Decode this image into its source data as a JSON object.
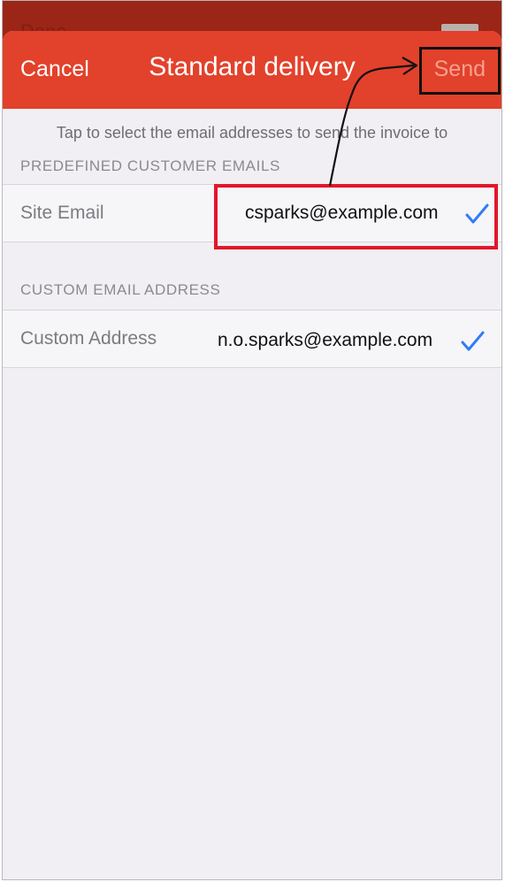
{
  "behind": {
    "label": "Done"
  },
  "navbar": {
    "cancel_label": "Cancel",
    "title": "Standard delivery",
    "send_label": "Send"
  },
  "hint": "Tap to select the email addresses to send the invoice to",
  "sections": [
    {
      "header": "PREDEFINED CUSTOMER EMAILS",
      "rows": [
        {
          "label": "Site Email",
          "value": "csparks@example.com",
          "checked": true
        }
      ]
    },
    {
      "header": "CUSTOM EMAIL ADDRESS",
      "rows": [
        {
          "label": "Custom Address",
          "value": "n.o.sparks@example.com",
          "checked": true
        }
      ]
    }
  ],
  "colors": {
    "accent": "#e2412b",
    "check": "#2f7df6",
    "highlight": "#e3162a"
  },
  "icons": {
    "check": "checkmark-icon"
  }
}
